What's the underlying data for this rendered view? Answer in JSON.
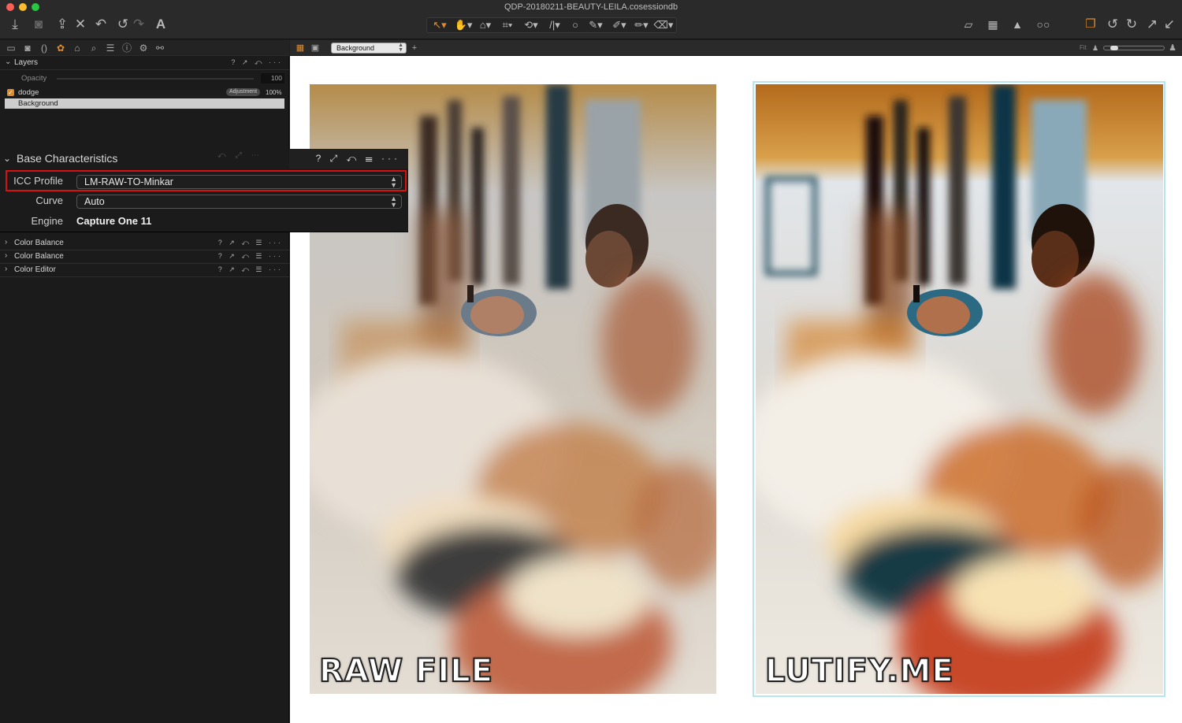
{
  "window": {
    "title": "QDP-20180211-BEAUTY-LEILA.cosessiondb"
  },
  "toolbar": {
    "left_icons": [
      "import-icon",
      "camera-icon",
      "export-icon",
      "delete-icon",
      "undo-icon",
      "undo-step-icon",
      "redo-icon",
      "text-icon"
    ],
    "right_icons": [
      "proof-icon",
      "grid-icon",
      "exposure-warning-icon",
      "glasses-icon",
      "variants-icon",
      "rotate-left-icon",
      "rotate-right-icon",
      "expand-icon",
      "collapse-icon"
    ],
    "tools": [
      "↖▾",
      "✋▾",
      "⌂▾",
      "⌗▾",
      "⟲▾",
      "/|\\▾",
      "○",
      "✎▾",
      "✐▾",
      "✏▾",
      "⌫▾"
    ]
  },
  "left_panel": {
    "tabs": [
      "library-tab",
      "capture-tab",
      "lens-tab",
      "color-tab",
      "exposure-tab",
      "details-tab",
      "adjustments-tab",
      "metadata-tab",
      "output-tab",
      "batch-tab"
    ],
    "layers": {
      "title": "Layers",
      "tools": "? ↗ ⤺ ···",
      "opacity_label": "Opacity",
      "opacity_value": "100",
      "items": [
        {
          "name": "dodge",
          "badge": "Adjustment",
          "percent": "100%"
        },
        {
          "name": "Background"
        }
      ]
    },
    "base_characteristics": {
      "title": "Base Characteristics",
      "tools": "? ⤢ ⤺ ☰ ···",
      "icc_label": "ICC Profile",
      "icc_value": "LM-RAW-TO-Minkar",
      "curve_label": "Curve",
      "curve_value": "Auto",
      "engine_label": "Engine",
      "engine_value": "Capture One 11"
    },
    "sections": [
      {
        "title": "Color Balance",
        "tools": "? ↗ ⤺ ☰ ···"
      },
      {
        "title": "Color Balance",
        "tools": "? ↗ ⤺ ☰ ···"
      },
      {
        "title": "Color Editor",
        "tools": "? ↗ ⤺ ☰ ···"
      }
    ]
  },
  "viewer": {
    "layer_select": "Background",
    "fit_label": "Fit",
    "zoom_level": 0.1,
    "images": [
      {
        "caption": "RAW FILE"
      },
      {
        "caption": "LUTIFY.ME"
      }
    ]
  }
}
